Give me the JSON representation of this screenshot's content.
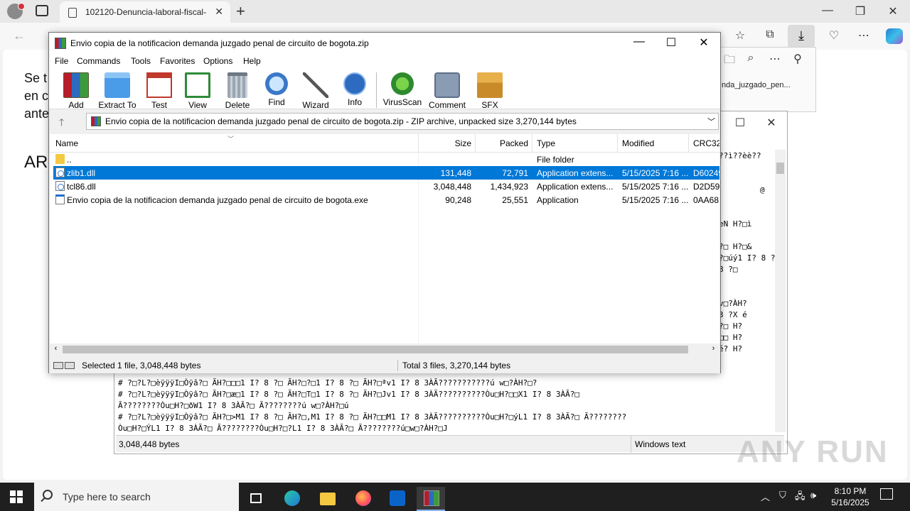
{
  "browser": {
    "tab_title": "102120-Denuncia-laboral-fiscal-j",
    "page_text_lines": [
      "Se t",
      "en c",
      "ante"
    ],
    "page_heading": "AR",
    "download_item": "nda_juzgado_pen..."
  },
  "winrar": {
    "title": "Envio copia de la notificacion demanda juzgado penal de circuito de bogota.zip",
    "menu": [
      "File",
      "Commands",
      "Tools",
      "Favorites",
      "Options",
      "Help"
    ],
    "toolbar": [
      {
        "label": "Add",
        "icon": "add-archive-icon"
      },
      {
        "label": "Extract To",
        "icon": "extract-folder-icon"
      },
      {
        "label": "Test",
        "icon": "test-clipboard-icon"
      },
      {
        "label": "View",
        "icon": "view-book-icon"
      },
      {
        "label": "Delete",
        "icon": "trash-icon"
      },
      {
        "label": "Find",
        "icon": "magnifier-icon"
      },
      {
        "label": "Wizard",
        "icon": "wizard-wand-icon"
      },
      {
        "label": "Info",
        "icon": "info-icon"
      },
      {
        "label": "VirusScan",
        "icon": "virus-scan-icon"
      },
      {
        "label": "Comment",
        "icon": "comment-icon"
      },
      {
        "label": "SFX",
        "icon": "sfx-box-icon"
      }
    ],
    "address": "Envio copia de la notificacion demanda juzgado penal de circuito de bogota.zip - ZIP archive, unpacked size 3,270,144 bytes",
    "columns": [
      "Name",
      "Size",
      "Packed",
      "Type",
      "Modified",
      "CRC32"
    ],
    "rows": [
      {
        "name": "..",
        "size": "",
        "packed": "",
        "type": "File folder",
        "modified": "",
        "crc": "",
        "icon": "folder-icon",
        "selected": false
      },
      {
        "name": "zlib1.dll",
        "size": "131,448",
        "packed": "72,791",
        "type": "Application extens...",
        "modified": "5/15/2025 7:16 ...",
        "crc": "D60249",
        "icon": "dll-file-icon",
        "selected": true
      },
      {
        "name": "tcl86.dll",
        "size": "3,048,448",
        "packed": "1,434,923",
        "type": "Application extens...",
        "modified": "5/15/2025 7:16 ...",
        "crc": "D2D59",
        "icon": "dll-file-icon",
        "selected": false
      },
      {
        "name": "Envio copia de la notificacion demanda juzgado penal de circuito de bogota.exe",
        "size": "90,248",
        "packed": "25,551",
        "type": "Application",
        "modified": "5/15/2025 7:16 ...",
        "crc": "0AA68",
        "icon": "exe-file-icon",
        "selected": false
      }
    ],
    "status_left": "Selected 1 file, 3,048,448 bytes",
    "status_right": "Total 3 files, 3,270,144 bytes"
  },
  "notepad": {
    "right_fragments": [
      "??ì??èè??",
      "@",
      "eN      H?□ì",
      "?□   H?□&",
      "?□úý1 I? 8 ?",
      "8   ?□",
      "v□?ÀH?",
      "3    ?X   é",
      "?□    H?",
      "□□    H?",
      "é?    H?"
    ],
    "lines": [
      "# ?□?L?□èÿÿÿI□Òÿâ?□    ÃH?□æ□1 I? 8        ?□    ÃH?□T□1 I? 8        ?□    ÃH?□Jv1 I? 8        3ÀÃ??????????Òu□H?□□X1 I? 8        3ÀÃ?□",
      "Ã????????Òu□H?□ðW1 I? 8        3ÀÃ?□    Ã????????ú    w□?ÀH?□ú",
      "# ?□?L?□èÿÿÿI□Òÿâ?□    ÃH?□>M1 I? 8        ?□    ÃH?□,M1 I? 8        ?□    ÃH?□□M1 I? 8        3ÀÃ??????????Òu□H?□ýL1 I? 8 3ÀÃ?□    Ã????????",
      "Òu□H?□ÝL1 I? 8        3ÀÃ?□    Ã????????Òu□H?□?L1 I? 8        3ÀÃ?□    Ã????????ú□w□?ÀH?□J"
    ],
    "partial_top_lines": [
      "# ?□?L?□èÿÿÿI□Òÿâ?□    ÃH?□□□1 I? 8        ?□    ÃH?□?□1 I? 8        ?□    ÃH?□ªv1 I? 8        3ÀÃ???????????ú    w□?ÀH?□?"
    ],
    "status_size": "3,048,448 bytes",
    "status_encoding": "Windows text"
  },
  "taskbar": {
    "search_placeholder": "Type here to search",
    "time": "8:10 PM",
    "date": "5/16/2025"
  },
  "watermark": "ANY RUN"
}
